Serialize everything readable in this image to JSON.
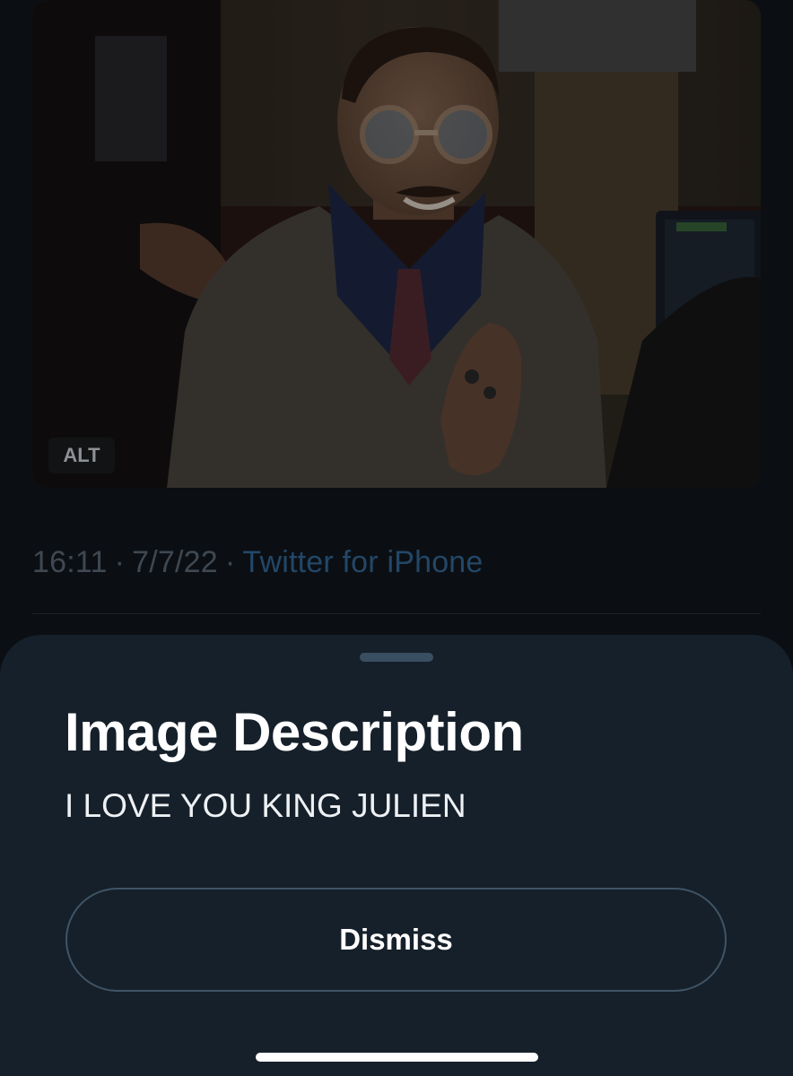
{
  "tweet": {
    "media": {
      "alt_badge": "ALT",
      "icon": "photo-of-man-in-courtroom"
    },
    "time": "16:11",
    "date": "7/7/22",
    "separator": "·",
    "source": "Twitter for iPhone"
  },
  "sheet": {
    "title": "Image Description",
    "description": "I LOVE YOU KING JULIEN",
    "dismiss_label": "Dismiss"
  },
  "colors": {
    "background": "#0b0f13",
    "sheet_background": "#16202a",
    "source_link": "#234767",
    "button_border": "#3f5466",
    "text_primary": "#ffffff"
  }
}
